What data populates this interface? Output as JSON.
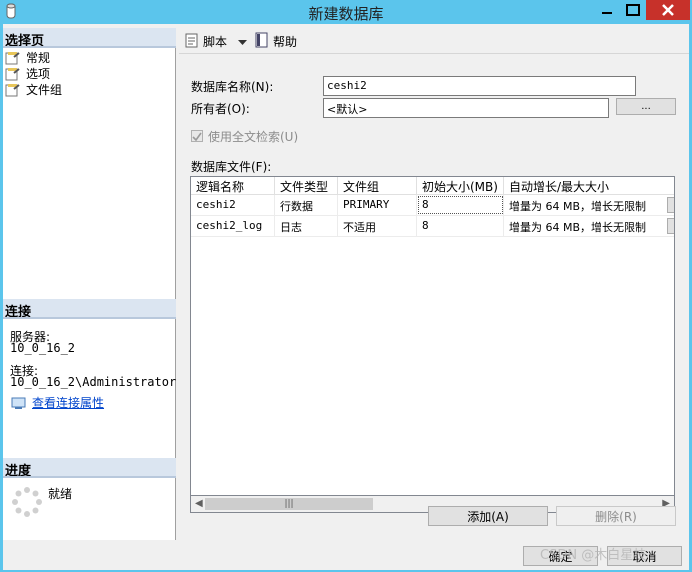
{
  "window": {
    "title": "新建数据库",
    "accent": "#5bc5ec",
    "close_color": "#c7312a"
  },
  "left": {
    "select_page": "选择页",
    "pages": [
      {
        "label": "常规",
        "icon": "page-wrench-icon"
      },
      {
        "label": "选项",
        "icon": "page-wrench-icon"
      },
      {
        "label": "文件组",
        "icon": "page-wrench-icon"
      }
    ],
    "connection": {
      "header": "连接",
      "server_label": "服务器:",
      "server_value": "10_0_16_2",
      "conn_label": "连接:",
      "conn_value": "10_0_16_2\\Administrator",
      "view_props_link": "查看连接属性"
    },
    "progress": {
      "header": "进度",
      "status": "就绪"
    }
  },
  "toolbar": {
    "script": "脚本",
    "help": "帮助"
  },
  "form": {
    "db_name_label": "数据库名称(N):",
    "db_name_value": "ceshi2",
    "owner_label": "所有者(O):",
    "owner_value": "<默认>",
    "owner_btn": "...",
    "fulltext_label": "使用全文检索(U)",
    "files_label": "数据库文件(F):"
  },
  "grid": {
    "columns": [
      "逻辑名称",
      "文件类型",
      "文件组",
      "初始大小(MB)",
      "自动增长/最大大小"
    ],
    "rows": [
      [
        "ceshi2",
        "行数据",
        "PRIMARY",
        "8",
        "增量为 64 MB，增长无限制"
      ],
      [
        "ceshi2_log",
        "日志",
        "不适用",
        "8",
        "增量为 64 MB，增长无限制"
      ]
    ],
    "cell_button": "..."
  },
  "buttons": {
    "add": "添加(A)",
    "remove": "删除(R)",
    "ok": "确定",
    "cancel": "取消"
  },
  "watermark": "CSDN @木白星枝"
}
